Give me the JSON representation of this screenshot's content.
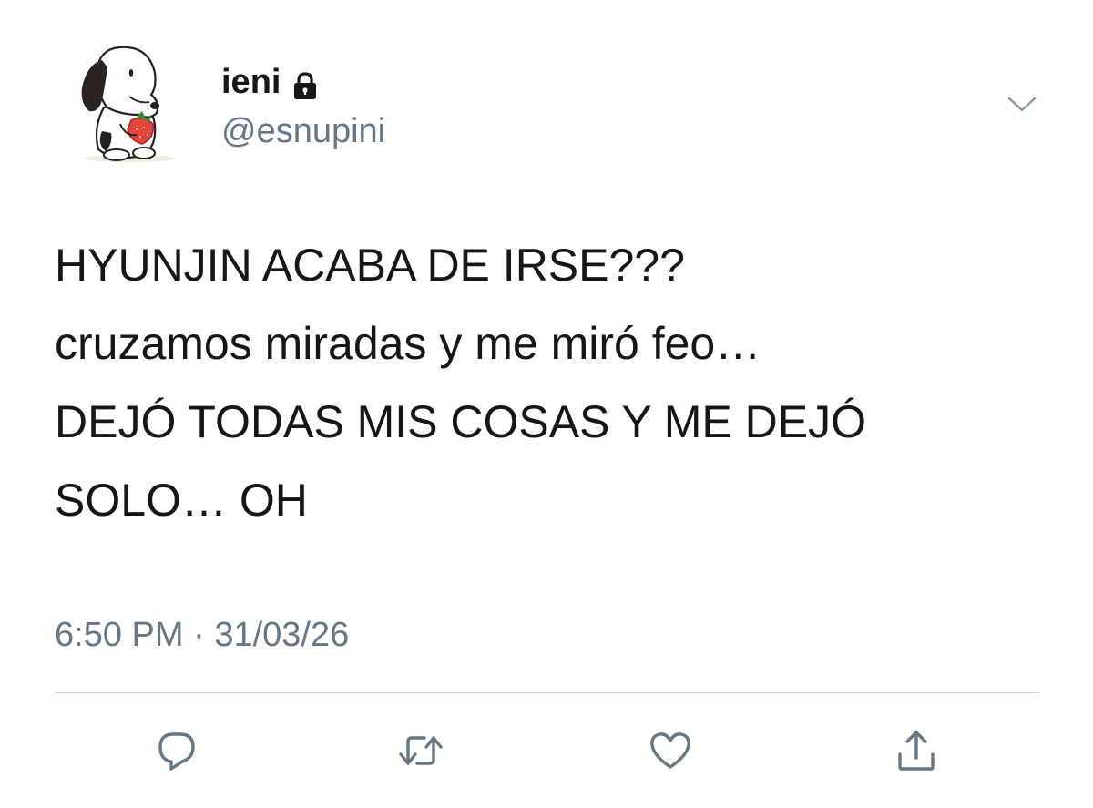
{
  "user": {
    "display_name": "ieni",
    "handle": "@esnupini",
    "avatar_icon": "snoopy-avatar",
    "protected_icon": "lock-icon"
  },
  "tweet": {
    "lines": [
      "HYUNJIN ACABA DE IRSE???",
      "cruzamos miradas y me miró feo…",
      "DEJÓ TODAS MIS COSAS Y ME DEJÓ",
      "SOLO… OH"
    ],
    "time": "6:50 PM",
    "separator": "·",
    "date": "31/03/26"
  },
  "actions": [
    "reply-icon",
    "retweet-icon",
    "like-icon",
    "share-icon"
  ],
  "colors": {
    "text": "#14171a",
    "secondary": "#657786",
    "divider": "#ccd6dd"
  }
}
